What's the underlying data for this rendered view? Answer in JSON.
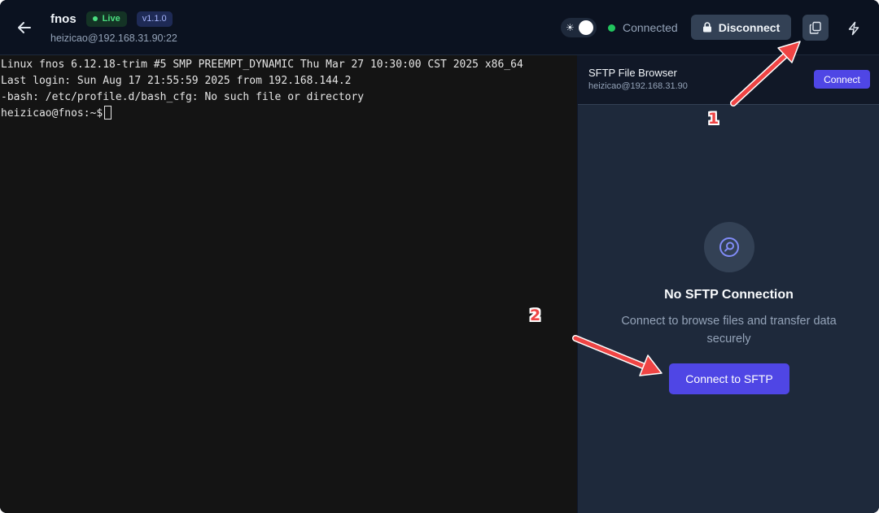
{
  "header": {
    "app_name": "fnos",
    "live_badge": "Live",
    "version_badge": "v1.1.0",
    "host": "heizicao@192.168.31.90:22",
    "status_text": "Connected",
    "disconnect_label": "Disconnect",
    "icons": {
      "back": "arrow-left-icon",
      "theme_toggle": "sun-icon",
      "lock": "lock-icon",
      "copy": "copy-icon",
      "bolt": "bolt-icon"
    }
  },
  "terminal": {
    "lines": [
      "Linux fnos 6.12.18-trim #5 SMP PREEMPT_DYNAMIC Thu Mar 27 10:30:00 CST 2025 x86_64",
      "Last login: Sun Aug 17 21:55:59 2025 from 192.168.144.2",
      "-bash: /etc/profile.d/bash_cfg: No such file or directory"
    ],
    "prompt": "heizicao@fnos:~$"
  },
  "sftp": {
    "title": "SFTP File Browser",
    "host": "heizicao@192.168.31.90",
    "connect_label": "Connect",
    "empty_title": "No SFTP Connection",
    "empty_description": "Connect to browse files and transfer data securely",
    "connect_sftp_label": "Connect to SFTP",
    "empty_icon": "search-icon"
  },
  "annotations": {
    "marker_1": "1",
    "marker_2": "2"
  },
  "colors": {
    "accent": "#4f46e5",
    "live_green": "#4ade80",
    "status_green": "#22c55e",
    "annotation_red": "#ef4444"
  }
}
